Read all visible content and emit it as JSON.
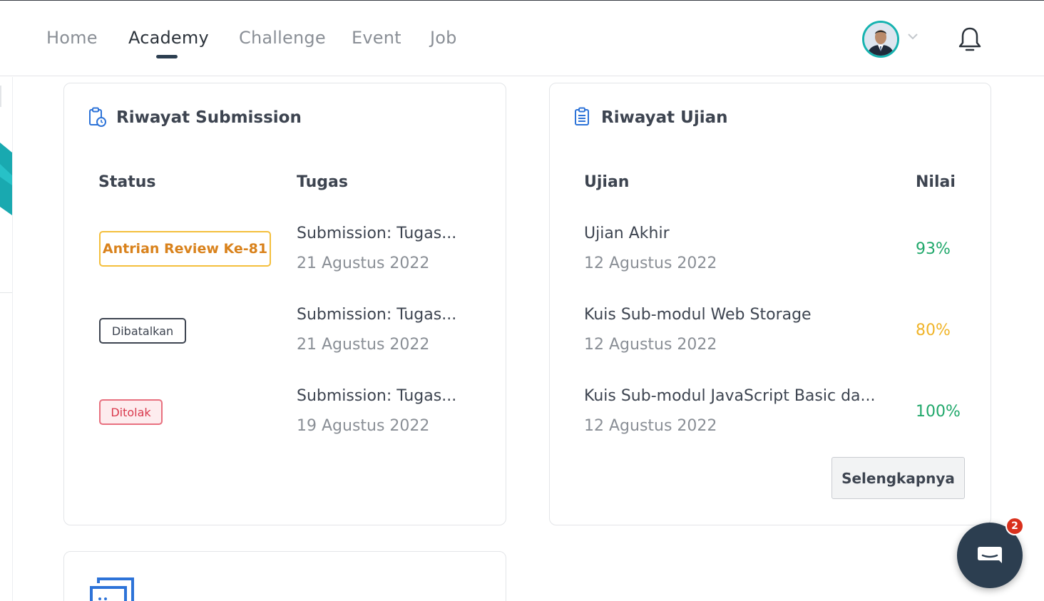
{
  "nav": {
    "items": [
      {
        "label": "Home"
      },
      {
        "label": "Academy"
      },
      {
        "label": "Challenge"
      },
      {
        "label": "Event"
      },
      {
        "label": "Job"
      }
    ],
    "active": "Academy"
  },
  "submission": {
    "title": "Riwayat Submission",
    "headers": {
      "status": "Status",
      "task": "Tugas"
    },
    "rows": [
      {
        "status": "Antrian Review Ke-81",
        "title": "Submission: Tugas...",
        "date": "21 Agustus 2022"
      },
      {
        "status": "Dibatalkan",
        "title": "Submission: Tugas...",
        "date": "21 Agustus 2022"
      },
      {
        "status": "Ditolak",
        "title": "Submission: Tugas...",
        "date": "19 Agustus 2022"
      }
    ]
  },
  "exam": {
    "title": "Riwayat Ujian",
    "headers": {
      "exam": "Ujian",
      "score": "Nilai"
    },
    "rows": [
      {
        "title": "Ujian Akhir",
        "date": "12 Agustus 2022",
        "score": "93%",
        "color": "#20a86b"
      },
      {
        "title": "Kuis Sub-modul Web Storage",
        "date": "12 Agustus 2022",
        "score": "80%",
        "color": "#f0b429"
      },
      {
        "title": "Kuis Sub-modul JavaScript Basic da...",
        "date": "12 Agustus 2022",
        "score": "100%",
        "color": "#20a86b"
      }
    ],
    "more_label": "Selengkapnya"
  },
  "chat": {
    "unread": "2"
  },
  "colors": {
    "accent": "#2d73d8",
    "teal": "#16b3b0",
    "dark": "#2c3e50"
  }
}
